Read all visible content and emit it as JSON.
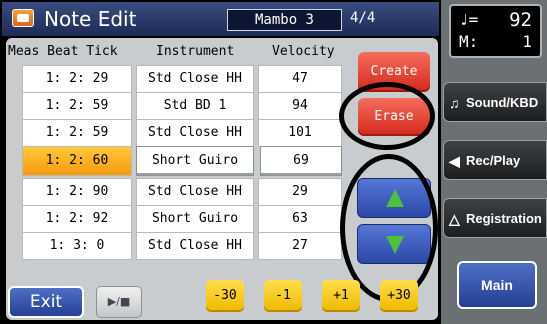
{
  "header": {
    "title": "Note Edit",
    "song": "Mambo 3",
    "time_signature": "4/4"
  },
  "table": {
    "columns": [
      "Meas Beat Tick",
      "Instrument",
      "Velocity"
    ],
    "rows": [
      {
        "position": "1: 2: 29",
        "instrument": "Std Close HH",
        "velocity": "47"
      },
      {
        "position": "1: 2: 59",
        "instrument": "Std BD 1",
        "velocity": "94"
      },
      {
        "position": "1: 2: 59",
        "instrument": "Std Close HH",
        "velocity": "101"
      },
      {
        "position": "1: 2: 60",
        "instrument": "Short Guiro",
        "velocity": "69"
      },
      {
        "position": "1: 2: 90",
        "instrument": "Std Close HH",
        "velocity": "29"
      },
      {
        "position": "1: 2: 92",
        "instrument": "Short Guiro",
        "velocity": "63"
      },
      {
        "position": "1: 3:  0",
        "instrument": "Std Close HH",
        "velocity": "27"
      }
    ],
    "selected_row": 3
  },
  "buttons": {
    "create": "Create",
    "erase": "Erase",
    "exit": "Exit",
    "play": "▶/■",
    "adjust": [
      "-30",
      "-1",
      "+1",
      "+30"
    ]
  },
  "side": {
    "tempo_note": "♩=",
    "tempo_value": "92",
    "measure_label": "M:",
    "measure_value": "1",
    "sound_kbd": "Sound/KBD",
    "rec_play": "Rec/Play",
    "registration": "Registration",
    "main": "Main"
  },
  "colors": {
    "title_bar": "#2a3a6a",
    "highlight": "#f5a614",
    "red_button": "#e03a2a",
    "blue_button": "#3a5bbe",
    "yellow_button": "#f7c81a"
  }
}
